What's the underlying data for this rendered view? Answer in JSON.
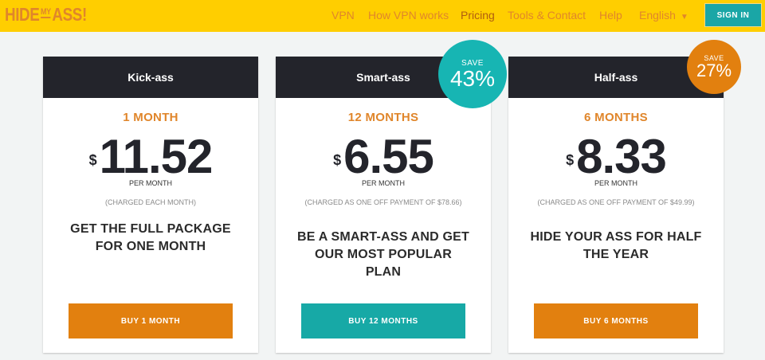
{
  "header": {
    "logo_parts": [
      "HIDE",
      "MY",
      "ASS!"
    ],
    "nav": [
      {
        "label": "VPN"
      },
      {
        "label": "How VPN works"
      },
      {
        "label": "Pricing"
      },
      {
        "label": "Tools & Contact"
      },
      {
        "label": "Help"
      },
      {
        "label": "English"
      }
    ],
    "signin_label": "SIGN IN"
  },
  "plans": [
    {
      "name": "Kick-ass",
      "term": "1 MONTH",
      "currency": "$",
      "price": "11.52",
      "per": "PER MONTH",
      "charged": "(CHARGED EACH MONTH)",
      "tagline": "GET THE FULL PACKAGE FOR ONE MONTH",
      "button": "BUY 1 MONTH"
    },
    {
      "name": "Smart-ass",
      "term": "12 MONTHS",
      "currency": "$",
      "price": "6.55",
      "per": "PER MONTH",
      "charged": "(CHARGED AS ONE OFF PAYMENT OF $78.66)",
      "tagline": "BE A SMART-ASS AND GET OUR MOST POPULAR PLAN",
      "button": "BUY 12 MONTHS",
      "badge_save": "SAVE",
      "badge_pct": "43%"
    },
    {
      "name": "Half-ass",
      "term": "6 MONTHS",
      "currency": "$",
      "price": "8.33",
      "per": "PER MONTH",
      "charged": "(CHARGED AS ONE OFF PAYMENT OF $49.99)",
      "tagline": "HIDE YOUR ASS FOR HALF THE YEAR",
      "button": "BUY 6 MONTHS",
      "badge_save": "SAVE",
      "badge_pct": "27%"
    }
  ],
  "colors": {
    "header_bg": "#ffce00",
    "accent_orange": "#e2800f",
    "accent_teal": "#17a9a6",
    "card_header": "#23242b"
  }
}
